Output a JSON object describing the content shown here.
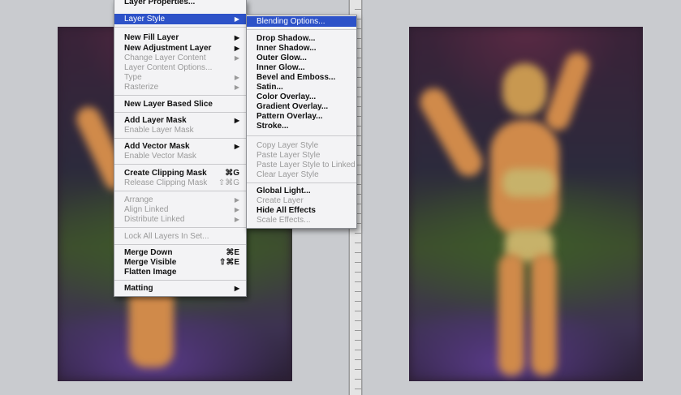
{
  "main_menu": {
    "items": [
      {
        "label": "Layer Properties...",
        "enabled": true
      },
      {
        "label": "Layer Style",
        "enabled": true,
        "submenu": true,
        "highlighted": true
      },
      {
        "label": "New Fill Layer",
        "enabled": true,
        "submenu": true
      },
      {
        "label": "New Adjustment Layer",
        "enabled": true,
        "submenu": true
      },
      {
        "label": "Change Layer Content",
        "enabled": false,
        "submenu": true
      },
      {
        "label": "Layer Content Options...",
        "enabled": false
      },
      {
        "label": "Type",
        "enabled": false,
        "submenu": true
      },
      {
        "label": "Rasterize",
        "enabled": false,
        "submenu": true
      },
      {
        "label": "New Layer Based Slice",
        "enabled": true
      },
      {
        "label": "Add Layer Mask",
        "enabled": true,
        "submenu": true
      },
      {
        "label": "Enable Layer Mask",
        "enabled": false
      },
      {
        "label": "Add Vector Mask",
        "enabled": true,
        "submenu": true
      },
      {
        "label": "Enable Vector Mask",
        "enabled": false
      },
      {
        "label": "Create Clipping Mask",
        "enabled": true,
        "shortcut": "⌘G"
      },
      {
        "label": "Release Clipping Mask",
        "enabled": false,
        "shortcut": "⇧⌘G"
      },
      {
        "label": "Arrange",
        "enabled": false,
        "submenu": true
      },
      {
        "label": "Align Linked",
        "enabled": false,
        "submenu": true
      },
      {
        "label": "Distribute Linked",
        "enabled": false,
        "submenu": true
      },
      {
        "label": "Lock All Layers In Set...",
        "enabled": false
      },
      {
        "label": "Merge Down",
        "enabled": true,
        "shortcut": "⌘E"
      },
      {
        "label": "Merge Visible",
        "enabled": true,
        "shortcut": "⇧⌘E"
      },
      {
        "label": "Flatten Image",
        "enabled": true
      },
      {
        "label": "Matting",
        "enabled": true,
        "submenu": true
      }
    ]
  },
  "layer_style_submenu": {
    "items": [
      {
        "label": "Blending Options...",
        "enabled": true,
        "highlighted": true
      },
      {
        "label": "Drop Shadow...",
        "enabled": true
      },
      {
        "label": "Inner Shadow...",
        "enabled": true
      },
      {
        "label": "Outer Glow...",
        "enabled": true
      },
      {
        "label": "Inner Glow...",
        "enabled": true
      },
      {
        "label": "Bevel and Emboss...",
        "enabled": true
      },
      {
        "label": "Satin...",
        "enabled": true
      },
      {
        "label": "Color Overlay...",
        "enabled": true
      },
      {
        "label": "Gradient Overlay...",
        "enabled": true
      },
      {
        "label": "Pattern Overlay...",
        "enabled": true
      },
      {
        "label": "Stroke...",
        "enabled": true
      },
      {
        "label": "Copy Layer Style",
        "enabled": false
      },
      {
        "label": "Paste Layer Style",
        "enabled": false
      },
      {
        "label": "Paste Layer Style to Linked",
        "enabled": false
      },
      {
        "label": "Clear Layer Style",
        "enabled": false
      },
      {
        "label": "Global Light...",
        "enabled": true
      },
      {
        "label": "Create Layer",
        "enabled": false
      },
      {
        "label": "Hide All Effects",
        "enabled": true
      },
      {
        "label": "Scale Effects...",
        "enabled": false
      }
    ]
  },
  "colors": {
    "highlight": "#2d52c8",
    "menu_bg": "#f3f3f5",
    "canvas_bg": "#c9cbcf"
  }
}
